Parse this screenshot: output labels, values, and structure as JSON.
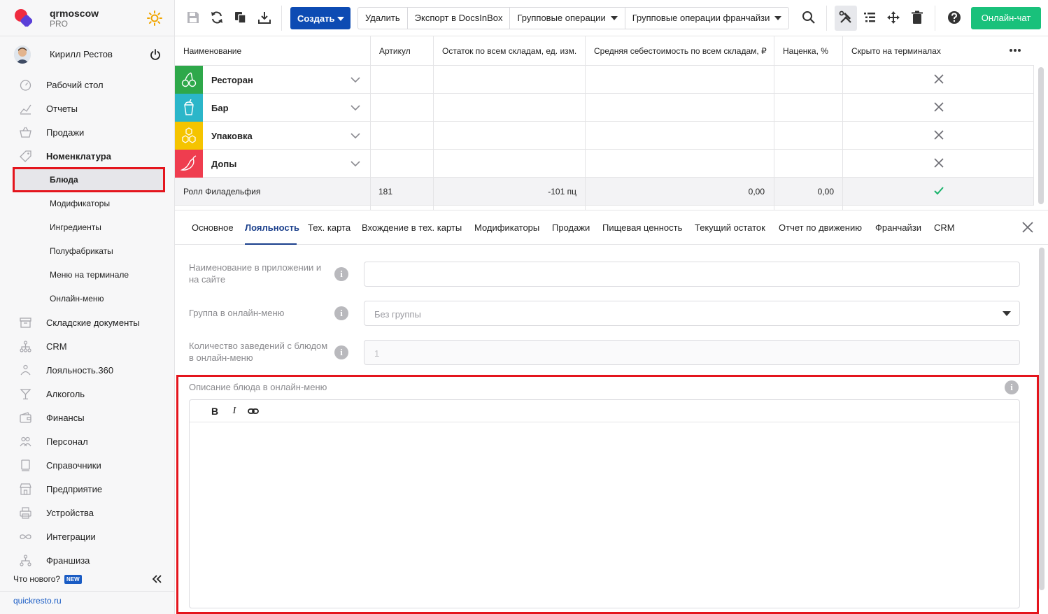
{
  "account": {
    "name": "qrmoscow",
    "plan": "PRO",
    "user": "Кирилл Рестов"
  },
  "sidebar": {
    "items": [
      {
        "label": "Рабочий стол",
        "icon": "gauge-icon"
      },
      {
        "label": "Отчеты",
        "icon": "chart-line-icon"
      },
      {
        "label": "Продажи",
        "icon": "basket-icon"
      },
      {
        "label": "Номенклатура",
        "icon": "tag-icon"
      }
    ],
    "sub_items": [
      {
        "label": "Блюда"
      },
      {
        "label": "Модификаторы"
      },
      {
        "label": "Ингредиенты"
      },
      {
        "label": "Полуфабрикаты"
      },
      {
        "label": "Меню на терминале"
      },
      {
        "label": "Онлайн-меню"
      }
    ],
    "items_after": [
      {
        "label": "Складские документы",
        "icon": "box-icon"
      },
      {
        "label": "CRM",
        "icon": "network-icon"
      },
      {
        "label": "Лояльность.360",
        "icon": "loyalty-icon"
      },
      {
        "label": "Алкоголь",
        "icon": "glass-icon"
      },
      {
        "label": "Финансы",
        "icon": "wallet-icon"
      },
      {
        "label": "Персонал",
        "icon": "people-icon"
      },
      {
        "label": "Справочники",
        "icon": "book-icon"
      },
      {
        "label": "Предприятие",
        "icon": "store-icon"
      },
      {
        "label": "Устройства",
        "icon": "printer-icon"
      },
      {
        "label": "Интеграции",
        "icon": "infinity-icon"
      },
      {
        "label": "Франшиза",
        "icon": "franchise-icon"
      }
    ],
    "whats_new": "Что нового?",
    "new_badge": "NEW",
    "link": "quickresto.ru"
  },
  "toolbar": {
    "create_label": "Создать",
    "delete_label": "Удалить",
    "export_label": "Экспорт в DocsInBox",
    "group_ops_label": "Групповые операции",
    "group_ops_franchise_label": "Групповые операции франчайзи",
    "chat_label": "Онлайн-чат"
  },
  "table": {
    "columns": [
      "Наименование",
      "Артикул",
      "Остаток по всем складам, ед. изм.",
      "Средняя себестоимость по всем складам, ₽",
      "Наценка, %",
      "Скрыто на терминалах"
    ],
    "groups": [
      {
        "name": "Ресторан",
        "color": "#2ea84a",
        "icon": "cherry-icon"
      },
      {
        "name": "Бар",
        "color": "#2bb6c9",
        "icon": "drink-cup-icon"
      },
      {
        "name": "Упаковка",
        "color": "#f5c400",
        "icon": "honeycomb-icon"
      },
      {
        "name": "Допы",
        "color": "#ef3d4f",
        "icon": "chili-pepper-icon"
      }
    ],
    "item_row": {
      "name": "Ролл Филадельфия",
      "article": "181",
      "stock": "-101 пц",
      "avg_cost": "0,00",
      "markup": "0,00"
    }
  },
  "tabs": [
    "Основное",
    "Лояльность",
    "Тех. карта",
    "Вхождение в тех. карты",
    "Модификаторы",
    "Продажи",
    "Пищевая ценность",
    "Текущий остаток",
    "Отчет по движению",
    "Франчайзи",
    "CRM"
  ],
  "active_tab": "Лояльность",
  "form": {
    "app_name_label": "Наименование в приложении и на сайте",
    "app_name_value": "",
    "online_group_label": "Группа в онлайн-меню",
    "online_group_value": "Без группы",
    "venues_count_label": "Количество заведений с блюдом в онлайн-меню",
    "venues_count_value": "1",
    "description_label": "Описание блюда в онлайн-меню",
    "editor_bold": "B",
    "editor_italic": "I",
    "info_glyph": "i"
  },
  "colors": {
    "accent": "#0d4bb3",
    "chat": "#19c17b",
    "highlight": "#e4151d",
    "check": "#19b36b"
  }
}
